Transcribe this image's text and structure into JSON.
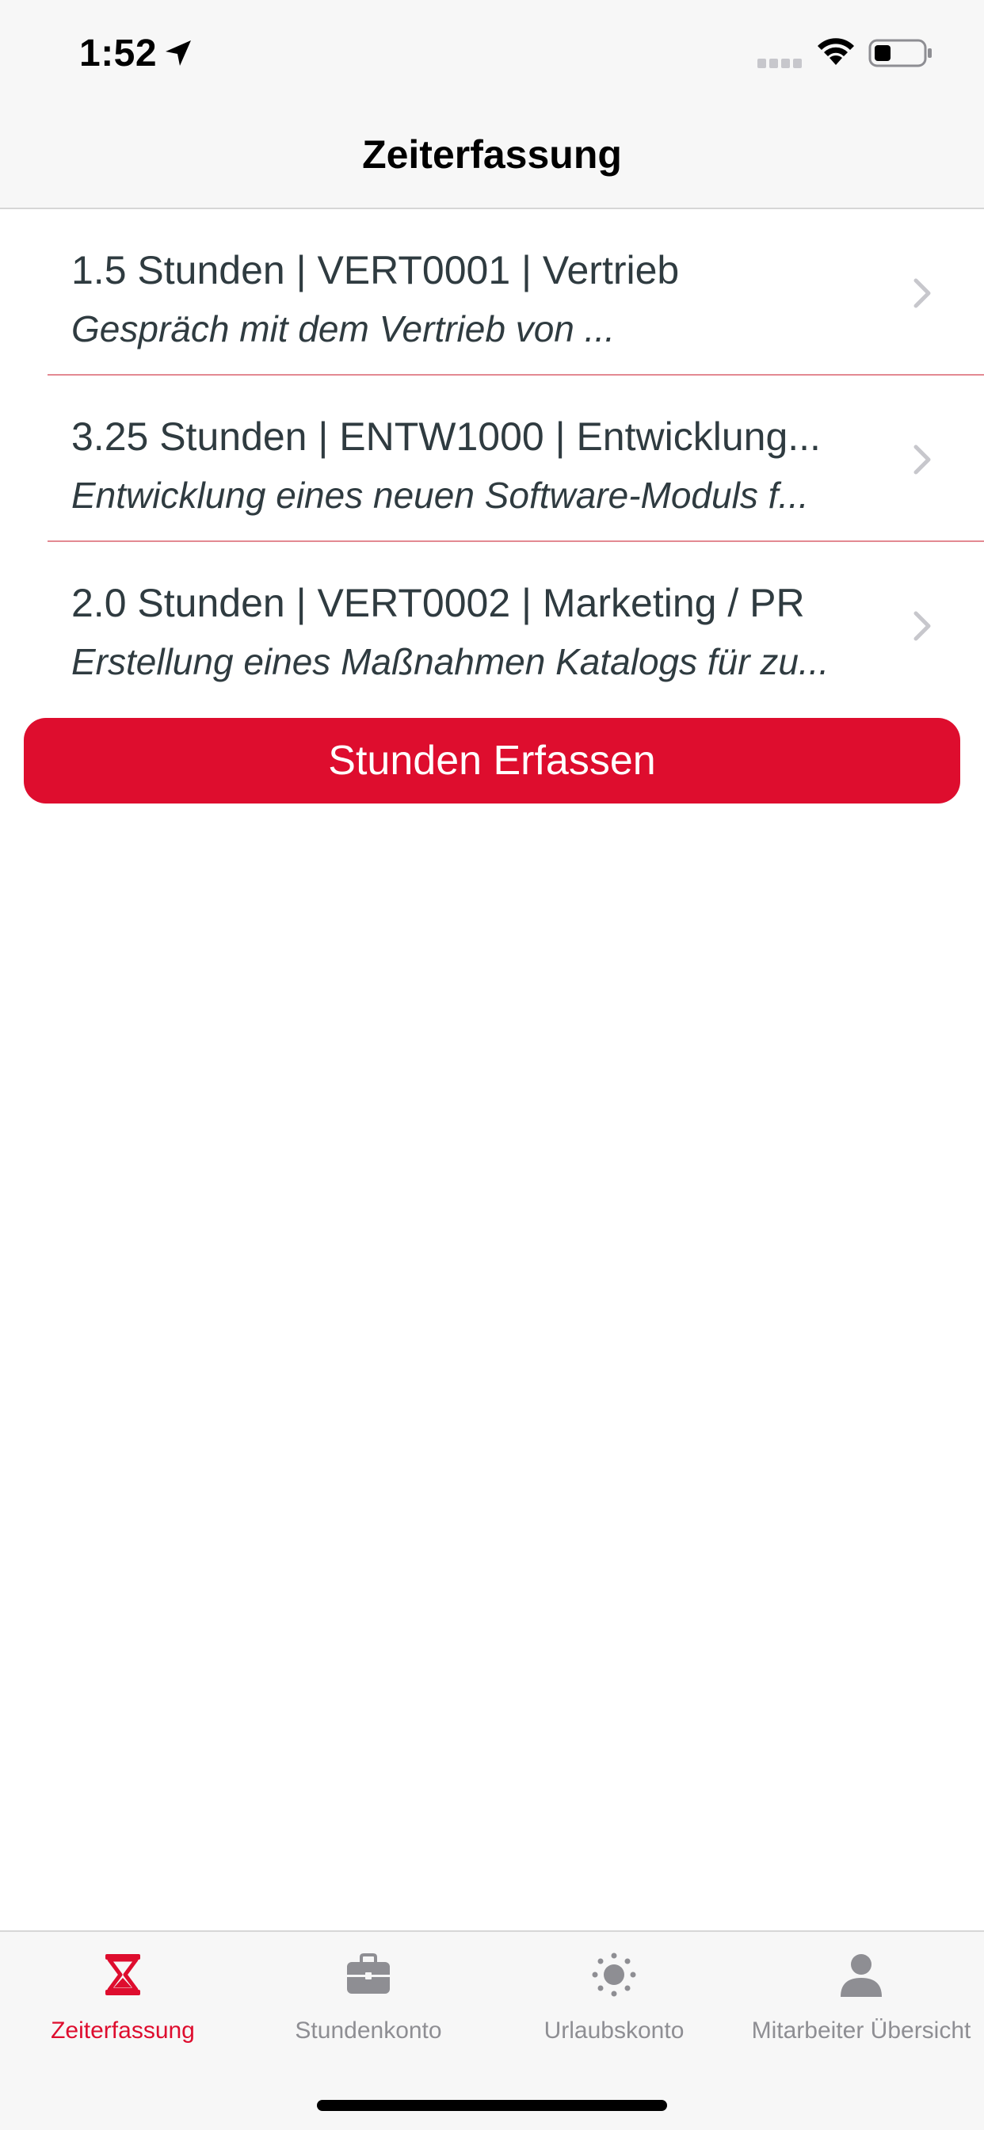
{
  "status_bar": {
    "time": "1:52"
  },
  "nav": {
    "title": "Zeiterfassung"
  },
  "entries": [
    {
      "title": "1.5 Stunden | VERT0001 | Vertrieb",
      "subtitle": "Gespräch mit dem Vertrieb von ..."
    },
    {
      "title": "3.25 Stunden | ENTW1000 | Entwicklung...",
      "subtitle": "Entwicklung eines neuen Software-Moduls f..."
    },
    {
      "title": "2.0 Stunden | VERT0002 | Marketing / PR",
      "subtitle": "Erstellung eines Maßnahmen Katalogs für zu..."
    }
  ],
  "primary_action": {
    "label": "Stunden Erfassen"
  },
  "tabs": [
    {
      "label": "Zeiterfassung",
      "icon": "hourglass-icon",
      "active": true
    },
    {
      "label": "Stundenkonto",
      "icon": "briefcase-icon",
      "active": false
    },
    {
      "label": "Urlaubskonto",
      "icon": "sun-icon",
      "active": false
    },
    {
      "label": "Mitarbeiter Übersicht",
      "icon": "person-icon",
      "active": false
    }
  ],
  "colors": {
    "accent": "#de0d2e",
    "text": "#2f3b40",
    "divider": "#e38992",
    "tab_inactive": "#8e8e93",
    "bar_background": "#f7f7f7"
  }
}
